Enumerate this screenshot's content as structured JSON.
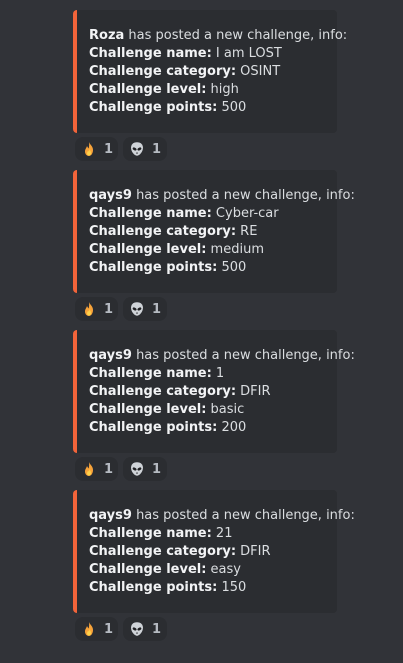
{
  "messages": [
    {
      "poster": "Roza",
      "intro": " has posted a new challenge, info:",
      "name_label": "Challenge name:",
      "name_value": " I am LOST",
      "category_label": "Challenge category:",
      "category_value": " OSINT",
      "level_label": "Challenge level:",
      "level_value": " high",
      "points_label": "Challenge points:",
      "points_value": " 500",
      "reactions": [
        {
          "icon": "fire-icon",
          "count": "1"
        },
        {
          "icon": "alien-icon",
          "count": "1"
        }
      ]
    },
    {
      "poster": "qays9",
      "intro": " has posted a new challenge, info:",
      "name_label": "Challenge name:",
      "name_value": " Cyber-car",
      "category_label": "Challenge category:",
      "category_value": " RE",
      "level_label": "Challenge level:",
      "level_value": " medium",
      "points_label": "Challenge points:",
      "points_value": " 500",
      "reactions": [
        {
          "icon": "fire-icon",
          "count": "1"
        },
        {
          "icon": "alien-icon",
          "count": "1"
        }
      ]
    },
    {
      "poster": "qays9",
      "intro": " has posted a new challenge, info:",
      "name_label": "Challenge name:",
      "name_value": " 1",
      "category_label": "Challenge category:",
      "category_value": " DFIR",
      "level_label": "Challenge level:",
      "level_value": " basic",
      "points_label": "Challenge points:",
      "points_value": " 200",
      "reactions": [
        {
          "icon": "fire-icon",
          "count": "1"
        },
        {
          "icon": "alien-icon",
          "count": "1"
        }
      ]
    },
    {
      "poster": "qays9",
      "intro": " has posted a new challenge, info:",
      "name_label": "Challenge name:",
      "name_value": " 21",
      "category_label": "Challenge category:",
      "category_value": " DFIR",
      "level_label": "Challenge level:",
      "level_value": " easy",
      "points_label": "Challenge points:",
      "points_value": " 150",
      "reactions": [
        {
          "icon": "fire-icon",
          "count": "1"
        },
        {
          "icon": "alien-icon",
          "count": "1"
        }
      ]
    }
  ],
  "colors": {
    "background": "#313338",
    "embed_background": "#2b2d31",
    "embed_accent": "#f2643a",
    "text": "#dbdee1",
    "reaction_text": "#b5bac1"
  }
}
